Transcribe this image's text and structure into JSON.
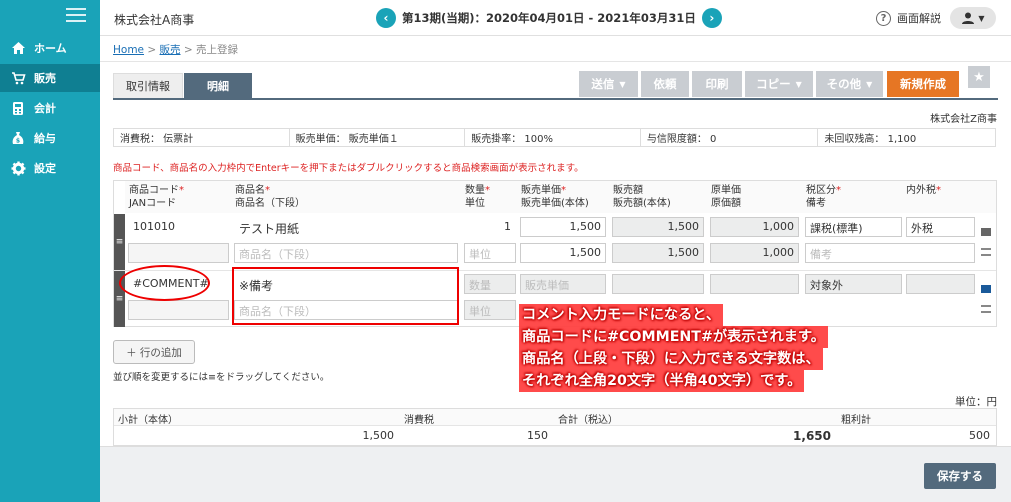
{
  "sidebar": {
    "items": [
      {
        "label": "ホーム",
        "icon": "home-icon"
      },
      {
        "label": "販売",
        "icon": "cart-icon"
      },
      {
        "label": "会計",
        "icon": "calculator-icon"
      },
      {
        "label": "給与",
        "icon": "money-bag-icon"
      },
      {
        "label": "設定",
        "icon": "gear-icon"
      }
    ],
    "active_index": 1
  },
  "header": {
    "company": "株式会社A商事",
    "period": "第13期(当期)：2020年04月01日 - 2021年03月31日",
    "help_label": "画面解説"
  },
  "breadcrumb": {
    "home": "Home",
    "sales": "販売",
    "current": "売上登録",
    "sep": ">"
  },
  "tabs": [
    {
      "label": "取引情報"
    },
    {
      "label": "明細"
    }
  ],
  "toolbar": {
    "send": "送信",
    "request": "依頼",
    "print": "印刷",
    "copy": "コピー",
    "other": "その他",
    "new": "新規作成"
  },
  "owner": "株式会社Z商事",
  "summary": {
    "tax": "消費税： 伝票計",
    "price": "販売単価： 販売単価１",
    "rate": "販売掛率： 100%",
    "credit": "与信限度額： 0",
    "unpaid": "未回収残高： 1,100"
  },
  "notice": "商品コード、商品名の入力枠内でEnterキーを押下またはダブルクリックすると商品検索画面が表示されます。",
  "grid": {
    "headers": {
      "code1": "商品コード",
      "code2": "JANコード",
      "name1": "商品名",
      "name2": "商品名（下段）",
      "qty1": "数量",
      "qty2": "単位",
      "price1": "販売単価",
      "price2": "販売単価(本体)",
      "amount1": "販売額",
      "amount2": "販売額(本体)",
      "cost1": "原単価",
      "cost2": "原価額",
      "taxcat1": "税区分",
      "taxcat2": "備考",
      "taxin": "内外税",
      "req": "*"
    },
    "row1": {
      "code": "101010",
      "name": "テスト用紙",
      "name_ph": "商品名（下段）",
      "qty": "1",
      "unit_ph": "単位",
      "price": "1,500",
      "price_body": "1,500",
      "amount": "1,500",
      "amount_body": "1,500",
      "cost": "1,000",
      "cost_amount": "1,000",
      "taxcat": "課税(標準)",
      "taxin": "外税",
      "memo_ph": "備考"
    },
    "row2": {
      "code": "#COMMENT#",
      "name": "※備考",
      "name_ph": "商品名（下段）",
      "qty_ph": "数量",
      "unit_ph": "単位",
      "price_ph": "販売単価",
      "taxcat": "対象外"
    }
  },
  "annotation": [
    "コメント入力モードになると、",
    "商品コードに#COMMENT#が表示されます。",
    "商品名（上段・下段）に入力できる文字数は、",
    "それぞれ全角20文字（半角40文字）です。"
  ],
  "add_row": "＋ 行の追加",
  "hint": "並び順を変更するには≡をドラッグしてください。",
  "unit": "単位：円",
  "totals": {
    "subtotal_label": "小計（本体）",
    "subtotal": "1,500",
    "tax_label": "消費税",
    "tax": "150",
    "total_label": "合計（税込）",
    "total": "1,650",
    "profit_label": "粗利計",
    "profit": "500"
  },
  "save": "保存する",
  "colors": {
    "accent": "#1aa3b8",
    "nav_active": "#0f7f92",
    "primary": "#536a7d",
    "orange": "#e67624",
    "annotation": "#e00000"
  }
}
